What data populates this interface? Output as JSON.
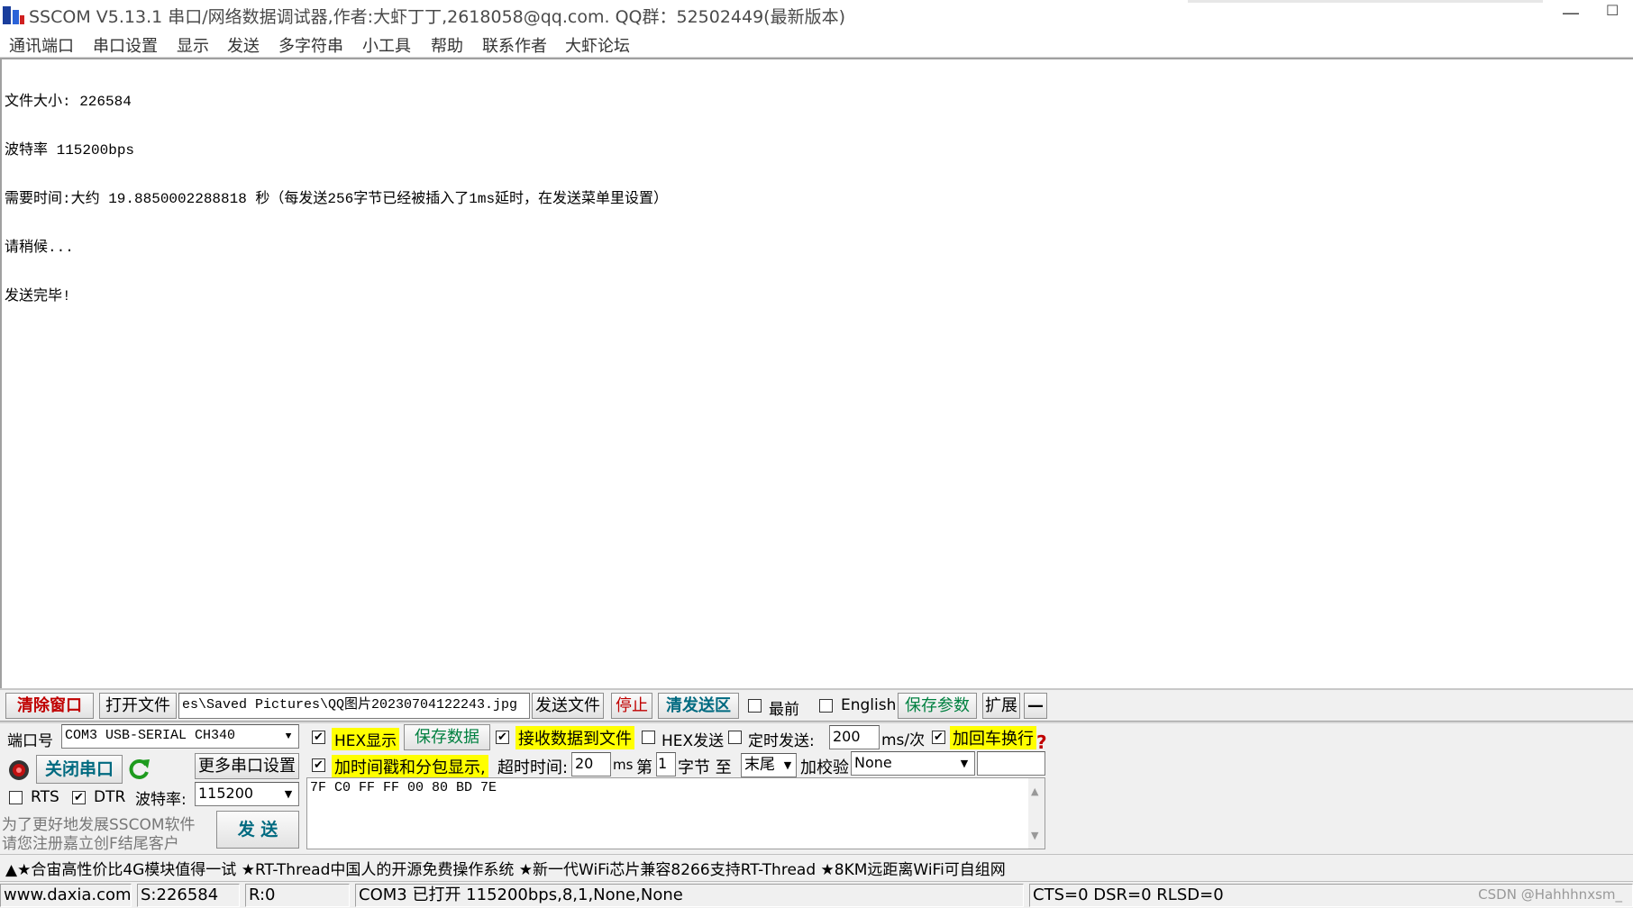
{
  "title_bar": {
    "title": "SSCOM V5.13.1 串口/网络数据调试器,作者:大虾丁丁,2618058@qq.com. QQ群：52502449(最新版本)",
    "minimize": "—",
    "restore": "☐"
  },
  "menu": [
    "通讯端口",
    "串口设置",
    "显示",
    "发送",
    "多字符串",
    "小工具",
    "帮助",
    "联系作者",
    "大虾论坛"
  ],
  "receive": {
    "lines": [
      "文件大小: 226584",
      "波特率 115200bps",
      "需要时间:大约 19.8850002288818 秒（每发送256字节已经被插入了1ms延时，在发送菜单里设置）",
      "请稍候...",
      "发送完毕!"
    ]
  },
  "toolbar": {
    "clear_window": "清除窗口",
    "open_file": "打开文件",
    "file_path": "es\\Saved Pictures\\QQ图片20230704122243.jpg",
    "send_file": "发送文件",
    "stop": "停止",
    "clear_send": "清发送区",
    "topmost": "最前",
    "english": "English",
    "save_params": "保存参数",
    "expand": "扩展",
    "collapse": "—"
  },
  "port": {
    "port_label": "端口号",
    "port_value": "COM3 USB-SERIAL CH340",
    "close_port": "关闭串口",
    "more_settings": "更多串口设置",
    "rts": "RTS",
    "dtr": "DTR",
    "baud_label": "波特率:",
    "baud_value": "115200",
    "promo_line1": "为了更好地发展SSCOM软件",
    "promo_line2": "请您注册嘉立创F结尾客户",
    "send": "发 送"
  },
  "options": {
    "hex_display": "HEX显示",
    "save_data": "保存数据",
    "recv_to_file": "接收数据到文件",
    "hex_send": "HEX发送",
    "timed_send": "定时发送:",
    "interval": "200",
    "interval_unit": "ms/次",
    "add_crlf": "加回车换行",
    "help_mark": "?",
    "timestamp": "加时间戳和分包显示,",
    "timeout_label": "超时时间:",
    "timeout_value": "20",
    "timeout_unit": "ms",
    "di": "第",
    "byte_index": "1",
    "byte_label": "字节 至",
    "end_value": "末尾",
    "checksum_label": "加校验",
    "checksum_value": "None"
  },
  "send_area": {
    "value": "7F C0 FF FF 00 80 BD 7E"
  },
  "ticker": "▲★合宙高性价比4G模块值得一试 ★RT-Thread中国人的开源免费操作系统 ★新一代WiFi芯片兼容8266支持RT-Thread ★8KM远距离WiFi可自组网",
  "status": {
    "site": "www.daxia.com",
    "sent": "S:226584",
    "received": "R:0",
    "port_state": "COM3 已打开  115200bps,8,1,None,None",
    "lines": "CTS=0 DSR=0 RLSD=0",
    "watermark": "CSDN @Hahhhnxsm_"
  }
}
